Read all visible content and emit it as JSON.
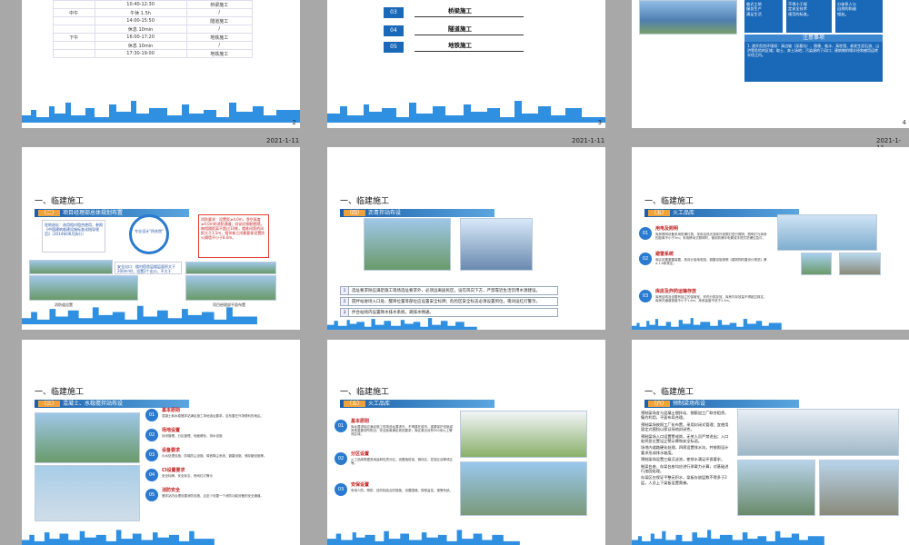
{
  "dates": {
    "row2": "2021-1-11",
    "row3": "2021-1-11",
    "row4": "2021-1-11"
  },
  "page_numbers": [
    "2",
    "3",
    "4"
  ],
  "slide2": {
    "rows": [
      {
        "period": "",
        "time": "10:40-12:30",
        "task": "桥梁施工"
      },
      {
        "period": "中午",
        "time": "午休 1.5h",
        "task": "/"
      },
      {
        "period": "",
        "time": "14:00-15:50",
        "task": "隧道施工"
      },
      {
        "period": "",
        "time": "休息 10min",
        "task": "/"
      },
      {
        "period": "下午",
        "time": "16:00-17:20",
        "task": "地铁施工"
      },
      {
        "period": "",
        "time": "休息 10min",
        "task": "/"
      },
      {
        "period": "",
        "time": "17:30-19:00",
        "task": "地铁施工"
      }
    ]
  },
  "slide3": {
    "items": [
      {
        "num": "03",
        "label": "桥梁施工"
      },
      {
        "num": "04",
        "label": "隧道施工"
      },
      {
        "num": "05",
        "label": "地铁施工"
      }
    ]
  },
  "slide4": {
    "col1": [
      "临近工地",
      "服务生产",
      "满足生活"
    ],
    "col2": [
      "不得小于规",
      "定安全技术",
      "规范的标准。"
    ],
    "col3": [
      "分体系人与",
      "自然的和谐",
      "相处。"
    ],
    "notice_title": "注意事项",
    "notice_text": "1. 避开危险环境如：高边坡（深基坑）、隐患、临水、高柱墙、易发生泥石流、山洪等危险的区域；取土、弃土场地；污染源的下风口；建筑物坍塌半径和感用运转半径之内。"
  },
  "heading": "一、临建施工",
  "slide5": {
    "section_num": "（二）",
    "section_title": "项目经理部总体规划布置",
    "box1": "驻地选址：选用相对租合使用，参照《中国建筑临建设施标准化指导规范》（2014年06月执行）",
    "center": "专业设计\"四合院\"",
    "redbox": "消防要求：设置距≥4.0m，净空高度≥4.0m的消防通道；封闭式钢制围墙，每相隔距离不超过10栋，楼栋间距的间距大于3.5m，相邻栋之间都要保设置防火隔墙不小于8.0m。",
    "box2": "安全出口：楼村宿舍层楼层面积大于200m²时，设置2个出口，不大于200m²可以1个安全出口；面积大于1200m²以上时，楼栋间距不小于25m；宿舍带专用的上楼应设置二楼；排气窗与楼栋距离不小于1.6m；楼梯抹距离不小于0.9m，扶手栏杆高度不小于1.2m。",
    "cap1": "消防道设置",
    "cap2": "项目经理部平面布置"
  },
  "slide6": {
    "section_num": "（四）",
    "section_title": "沥青拌站布设",
    "items": [
      {
        "n": "1",
        "text": "选址要求除应满足施工现场选址要求外，必须远离居民区，设在风向下方，严禁靠近生活饮用水源建设。"
      },
      {
        "n": "2",
        "text": "搅拌站进场入口处、醒目位置等部位应设置安全标牌；危险区安全标志必须设置到位，夜间设红灯警示。"
      },
      {
        "n": "3",
        "text": "拌合站场内设置降水排水系统，疏排水畅通。"
      }
    ]
  },
  "slide7": {
    "section_num": "（五）",
    "section_title": "火工品库",
    "items": [
      {
        "n": "01",
        "title": "用电及照明",
        "text": "库房照明设备采用防爆灯具，采用自然光或库外投照灯进行照明，照明灯与库房的距离不小于3m；采用移动式照明时，使用防爆手电筒或手提式防爆应急灯。"
      },
      {
        "n": "02",
        "title": "避雷系统",
        "text": "库区设置避雷装置，其设计接地电阻，避雷设施按照《建筑物防雷设计规范》第4.1.6条规定。"
      },
      {
        "n": "03",
        "title": "库房及炸药运输存放",
        "text": "库房结构及设置有独立的保管室，炸药分类存放，库房内存放量不得超过核定，库房内通道宽度不小于1.6m，库房高度不低于2.5m。"
      }
    ]
  },
  "slide8": {
    "section_num": "（三）",
    "section_title": "混凝土、水稳搅拌站布设",
    "items": [
      {
        "n": "01",
        "title": "基本原则",
        "text": "混凝土和水稳搅拌站满足施工场地选址要求，应布置在外场便利的地区。"
      },
      {
        "n": "02",
        "title": "场地设置",
        "text": "封闭管理、分区管理、地面硬化、排水设施"
      },
      {
        "n": "03",
        "title": "设备要求",
        "text": "污水处理设施、防噪防尘设施、噪音降尘系统、避雷设施、储存罐设施等。"
      },
      {
        "n": "04",
        "title": "CI设置要求",
        "text": "安全标牌、安全标志、夜间红灯警示"
      },
      {
        "n": "05",
        "title": "消防安全",
        "text": "搅拌站内合理设置消防设施，且至少设置一个消防功能设备的安全通道。"
      }
    ]
  },
  "slide9": {
    "section_num": "（五）",
    "section_title": "火工品库",
    "items": [
      {
        "n": "01",
        "title": "基本原则",
        "text": "库址要求除应满足施工现场选址要求外，不得建在城市，重要保护设施或其他重要场所附近；安全距离满足规范要求；库区周边设有500米以上警戒区域。"
      },
      {
        "n": "02",
        "title": "分区设置",
        "text": "火工品库根据其用途和性质分区，设置值班室、储存区、发放区及警戒区等。"
      },
      {
        "n": "03",
        "title": "安保设置",
        "text": "采用人防、物防、技防相结合的措施，设置围墙、视频监控、报警系统。"
      }
    ]
  },
  "slide10": {
    "section_num": "（六）",
    "section_title": "预制梁场布设",
    "items": [
      "预制梁场宜与混凝土搅拌站、钢筋加工厂联合租赁，集约利用，平面布局合理。",
      "预制梁场按照工厂化布置，采用封闭式管理；宜使用固定式围挡以保证场地封闭性。",
      "预制梁场入口设置警戒岗，无关人员严禁进出；入口处明显位置设立警示牌和安全标语。",
      "场地内道路硬化处理，四周设置排水沟，并按照设计要求形成排水坡度。",
      "预制梁场设置三级沉淀池，使排水满足环保要求。",
      "制梁台座、存梁台座均应进行承载力计算，对基础进行加固处理。",
      "存梁区应保证平整无积水，梁板存放层数不得多于2层，人员上下梁板设置爬梯。"
    ]
  }
}
